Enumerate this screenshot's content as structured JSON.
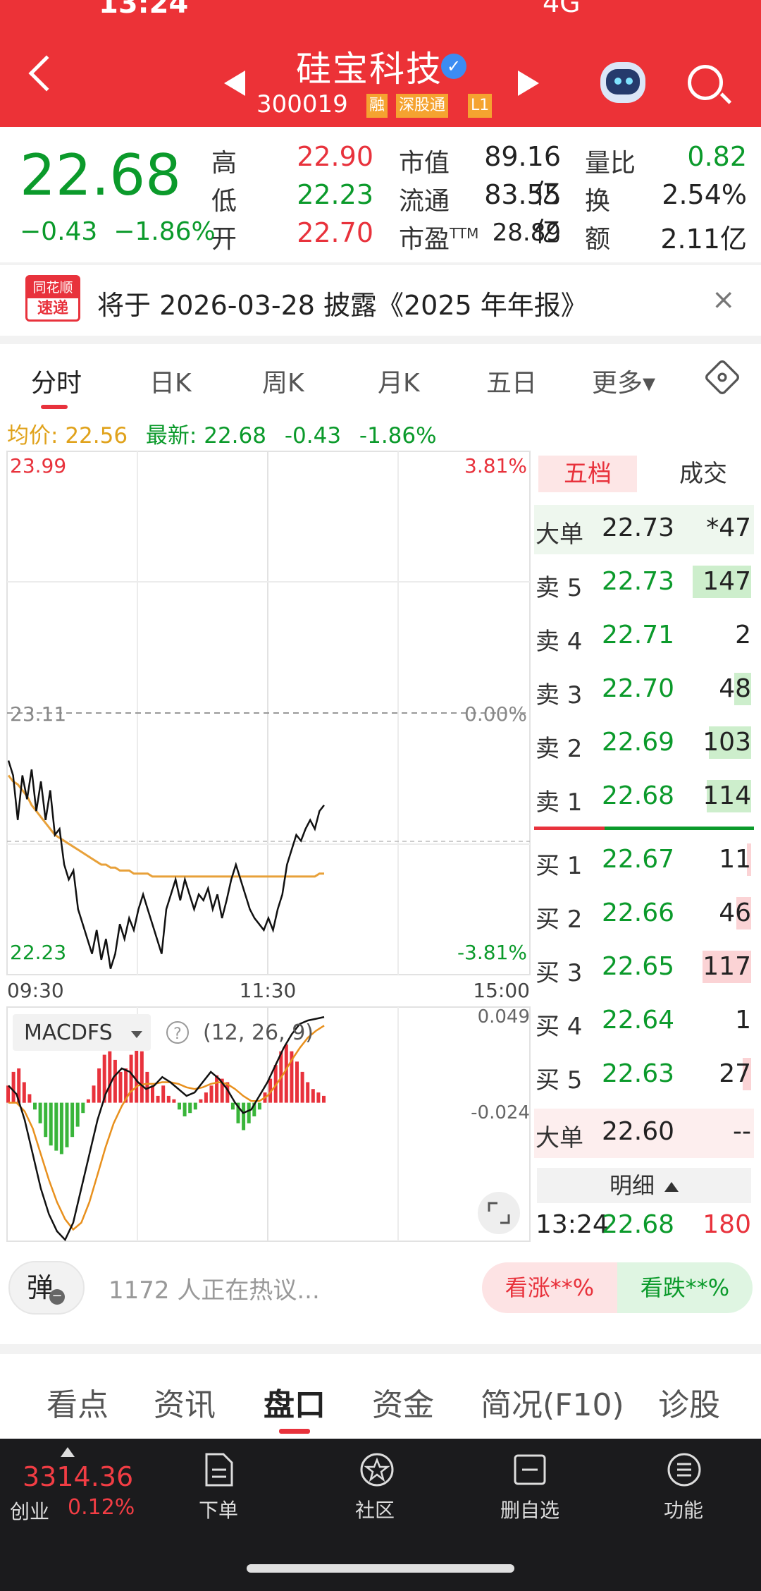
{
  "status": {
    "time": "13:24",
    "network": "4G"
  },
  "header": {
    "stock_name": "硅宝科技",
    "stock_code": "300019",
    "tags": [
      "融",
      "深股通",
      "L1"
    ],
    "colors": {
      "bg": "#ec3237"
    }
  },
  "quote": {
    "price": "22.68",
    "change": "−0.43",
    "change_pct": "−1.86%",
    "labels": {
      "high": "高",
      "low": "低",
      "open": "开",
      "mktcap": "市值",
      "float": "流通",
      "pe": "市盈",
      "pe_sup": "TTM",
      "vol_ratio": "量比",
      "turnover": "换",
      "amount": "额"
    },
    "high": "22.90",
    "low": "22.23",
    "open": "22.70",
    "mktcap": "89.16亿",
    "float": "83.55亿",
    "pe": "28.89",
    "vol_ratio": "0.82",
    "turnover": "2.54%",
    "amount": "2.11亿"
  },
  "news": {
    "logo_top": "同花顺",
    "logo_bottom": "速递",
    "text": "将于 2026-03-28 披露《2025 年年报》",
    "close": "×"
  },
  "period_tabs": [
    "分时",
    "日K",
    "周K",
    "月K",
    "五日",
    "更多▾"
  ],
  "info_line": {
    "avg_label": "均价:",
    "avg": "22.56",
    "latest_label": "最新:",
    "latest": "22.68",
    "chg": "-0.43",
    "chg_pct": "-1.86%"
  },
  "chart_data": {
    "type": "line",
    "title": "",
    "y_top": "23.99",
    "y_mid": "23.11",
    "y_bottom": "22.23",
    "pct_top": "3.81%",
    "pct_mid": "0.00%",
    "pct_bottom": "-3.81%",
    "x_ticks": [
      "09:30",
      "11:30",
      "15:00"
    ],
    "ylim": [
      22.23,
      23.99
    ],
    "price": [
      22.95,
      22.9,
      22.75,
      22.9,
      22.82,
      22.92,
      22.78,
      22.88,
      22.75,
      22.85,
      22.7,
      22.72,
      22.6,
      22.55,
      22.58,
      22.45,
      22.4,
      22.35,
      22.3,
      22.38,
      22.28,
      22.35,
      22.25,
      22.3,
      22.4,
      22.35,
      22.42,
      22.38,
      22.45,
      22.5,
      22.45,
      22.4,
      22.35,
      22.3,
      22.45,
      22.5,
      22.55,
      22.48,
      22.55,
      22.5,
      22.45,
      22.5,
      22.48,
      22.52,
      22.45,
      22.5,
      22.42,
      22.48,
      22.55,
      22.6,
      22.55,
      22.5,
      22.45,
      22.42,
      22.4,
      22.38,
      22.42,
      22.38,
      22.45,
      22.5,
      22.6,
      22.65,
      22.7,
      22.68,
      22.72,
      22.75,
      22.72,
      22.78,
      22.8
    ],
    "avg": [
      22.9,
      22.88,
      22.87,
      22.85,
      22.83,
      22.8,
      22.78,
      22.76,
      22.74,
      22.72,
      22.7,
      22.69,
      22.68,
      22.67,
      22.66,
      22.65,
      22.64,
      22.63,
      22.62,
      22.61,
      22.6,
      22.6,
      22.59,
      22.59,
      22.58,
      22.58,
      22.58,
      22.57,
      22.57,
      22.57,
      22.57,
      22.56,
      22.56,
      22.56,
      22.56,
      22.56,
      22.56,
      22.56,
      22.56,
      22.56,
      22.56,
      22.56,
      22.56,
      22.56,
      22.56,
      22.56,
      22.56,
      22.56,
      22.56,
      22.56,
      22.56,
      22.56,
      22.56,
      22.56,
      22.56,
      22.56,
      22.56,
      22.56,
      22.56,
      22.56,
      22.56,
      22.56,
      22.56,
      22.56,
      22.56,
      22.56,
      22.56,
      22.57,
      22.57
    ],
    "macd": {
      "label": "MACDFS",
      "params": "(12, 26, 9)",
      "max_label": "0.049",
      "min_label": "-0.024",
      "ylim": [
        -0.08,
        0.055
      ],
      "hist": [
        0.01,
        0.018,
        0.02,
        0.012,
        0.005,
        -0.004,
        -0.012,
        -0.02,
        -0.025,
        -0.028,
        -0.03,
        -0.026,
        -0.02,
        -0.014,
        -0.006,
        0.002,
        0.01,
        0.02,
        0.028,
        0.03,
        0.025,
        0.018,
        0.02,
        0.028,
        0.034,
        0.03,
        0.018,
        0.01,
        0.004,
        0.01,
        0.004,
        0.002,
        -0.004,
        -0.008,
        -0.006,
        -0.004,
        0.002,
        0.006,
        0.01,
        0.016,
        0.014,
        0.012,
        -0.004,
        -0.012,
        -0.016,
        -0.012,
        -0.008,
        -0.004,
        0.006,
        0.014,
        0.022,
        0.03,
        0.034,
        0.03,
        0.024,
        0.018,
        0.012,
        0.008,
        0.006,
        0.004
      ],
      "dif": [
        0.01,
        0.005,
        -0.01,
        -0.03,
        -0.05,
        -0.065,
        -0.075,
        -0.08,
        -0.07,
        -0.05,
        -0.03,
        -0.01,
        0.005,
        0.015,
        0.02,
        0.018,
        0.012,
        0.008,
        0.01,
        0.015,
        0.012,
        0.008,
        0.004,
        0.006,
        0.012,
        0.018,
        0.014,
        0.008,
        0.0,
        -0.006,
        -0.004,
        0.004,
        0.012,
        0.022,
        0.032,
        0.04,
        0.046,
        0.048,
        0.049,
        0.05
      ],
      "dea": [
        0.0,
        0.0,
        -0.005,
        -0.015,
        -0.03,
        -0.045,
        -0.058,
        -0.068,
        -0.074,
        -0.07,
        -0.058,
        -0.042,
        -0.026,
        -0.012,
        -0.002,
        0.006,
        0.01,
        0.011,
        0.011,
        0.012,
        0.012,
        0.011,
        0.009,
        0.008,
        0.009,
        0.011,
        0.012,
        0.011,
        0.008,
        0.004,
        0.001,
        0.001,
        0.004,
        0.01,
        0.017,
        0.025,
        0.032,
        0.038,
        0.042,
        0.045
      ]
    }
  },
  "order_book": {
    "tabs": [
      "五档",
      "成交"
    ],
    "big_sell": {
      "label": "大单",
      "price": "22.73",
      "vol": "*47"
    },
    "asks": [
      {
        "label": "卖 5",
        "price": "22.73",
        "vol": "147",
        "bar": 0.55
      },
      {
        "label": "卖 4",
        "price": "22.71",
        "vol": "2",
        "bar": 0
      },
      {
        "label": "卖 3",
        "price": "22.70",
        "vol": "48",
        "bar": 0.16
      },
      {
        "label": "卖 2",
        "price": "22.69",
        "vol": "103",
        "bar": 0.4
      },
      {
        "label": "卖 1",
        "price": "22.68",
        "vol": "114",
        "bar": 0.42
      }
    ],
    "bids": [
      {
        "label": "买 1",
        "price": "22.67",
        "vol": "11",
        "bar": 0.04
      },
      {
        "label": "买 2",
        "price": "22.66",
        "vol": "46",
        "bar": 0.14
      },
      {
        "label": "买 3",
        "price": "22.65",
        "vol": "117",
        "bar": 0.46
      },
      {
        "label": "买 4",
        "price": "22.64",
        "vol": "1",
        "bar": 0
      },
      {
        "label": "买 5",
        "price": "22.63",
        "vol": "27",
        "bar": 0.08
      }
    ],
    "big_buy": {
      "label": "大单",
      "price": "22.60",
      "vol": "--"
    },
    "detail_label": "明细",
    "last_trade": {
      "time": "13:24",
      "price": "22.68",
      "vol": "180"
    }
  },
  "discussion": {
    "danmu": "弹",
    "text": "1172 人正在热议...",
    "bull": "看涨**%",
    "bear": "看跌**%"
  },
  "bottom_tabs": [
    "看点",
    "资讯",
    "盘口",
    "资金",
    "简况(F10)",
    "诊股"
  ],
  "index": {
    "value": "3314.36",
    "name": "创业",
    "pct": "0.12%"
  },
  "nav": {
    "order": "下单",
    "community": "社区",
    "remove": "删自选",
    "functions": "功能"
  }
}
